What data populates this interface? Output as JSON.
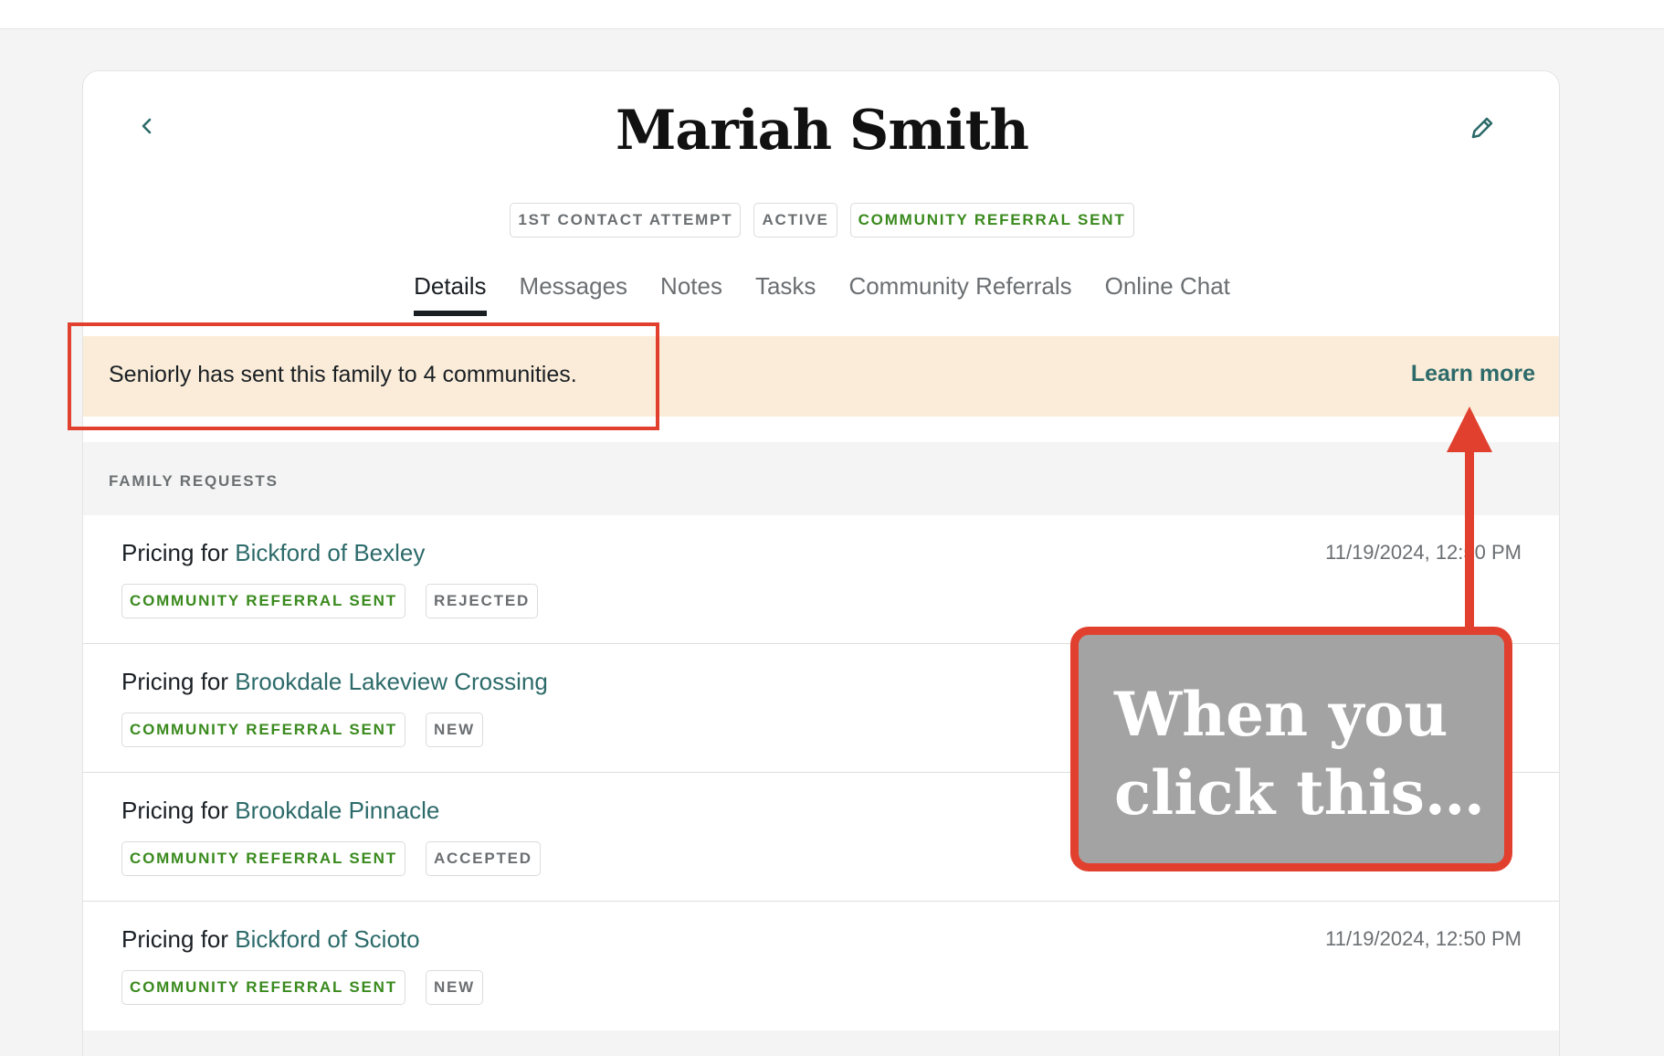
{
  "header": {
    "title": "Mariah Smith",
    "back_icon": "chevron-left-icon",
    "edit_icon": "pencil-icon"
  },
  "badges": [
    {
      "label": "1ST CONTACT ATTEMPT",
      "style": "neutral"
    },
    {
      "label": "ACTIVE",
      "style": "neutral"
    },
    {
      "label": "COMMUNITY REFERRAL SENT",
      "style": "green"
    }
  ],
  "tabs": [
    {
      "label": "Details",
      "active": true
    },
    {
      "label": "Messages",
      "active": false
    },
    {
      "label": "Notes",
      "active": false
    },
    {
      "label": "Tasks",
      "active": false
    },
    {
      "label": "Community Referrals",
      "active": false
    },
    {
      "label": "Online Chat",
      "active": false
    }
  ],
  "banner": {
    "text": "Seniorly has sent this family to 4 communities.",
    "link": "Learn more"
  },
  "section": {
    "label": "FAMILY REQUESTS",
    "rows": [
      {
        "prefix": "Pricing for",
        "community": "Bickford of Bexley",
        "date": "11/19/2024, 12:50 PM",
        "status_badge": "COMMUNITY REFERRAL SENT",
        "state_badge": "REJECTED"
      },
      {
        "prefix": "Pricing for",
        "community": "Brookdale Lakeview Crossing",
        "date": "",
        "status_badge": "COMMUNITY REFERRAL SENT",
        "state_badge": "NEW"
      },
      {
        "prefix": "Pricing for",
        "community": "Brookdale Pinnacle",
        "date": "",
        "status_badge": "COMMUNITY REFERRAL SENT",
        "state_badge": "ACCEPTED"
      },
      {
        "prefix": "Pricing for",
        "community": "Bickford of Scioto",
        "date": "11/19/2024, 12:50 PM",
        "status_badge": "COMMUNITY REFERRAL SENT",
        "state_badge": "NEW"
      }
    ]
  },
  "annotation": {
    "callout_text": "When you click this…"
  },
  "colors": {
    "accent_teal": "#2d6a6a",
    "badge_green": "#3a8a1e",
    "banner_bg": "#faecd8",
    "annotation_red": "#e1402e"
  }
}
